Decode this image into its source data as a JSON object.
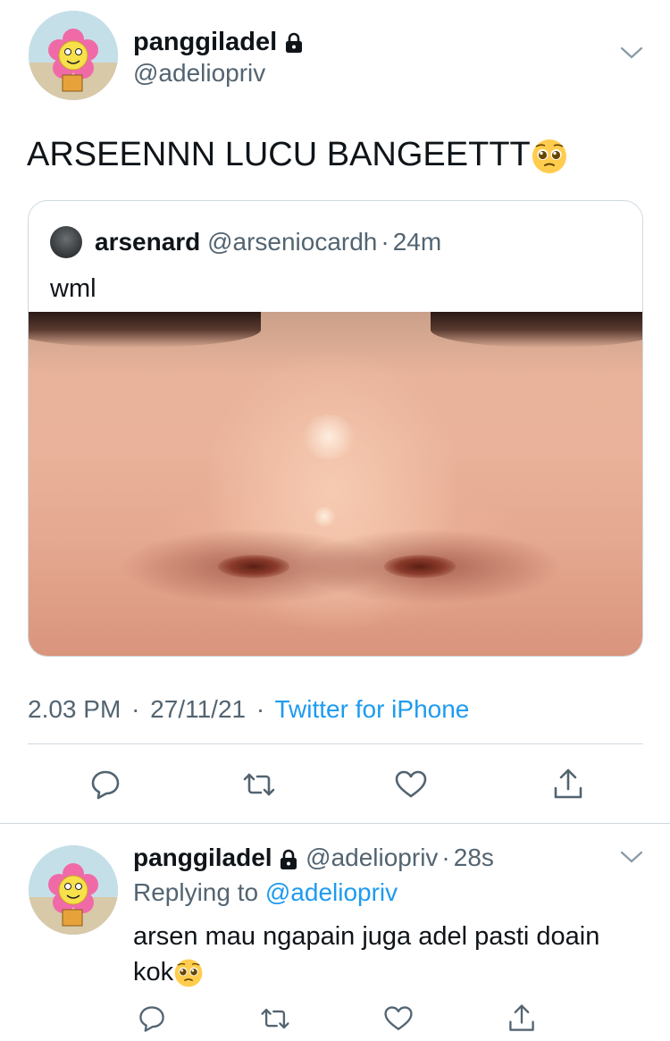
{
  "main_tweet": {
    "display_name": "panggiladel",
    "handle": "@adeliopriv",
    "text": "ARSEENNN LUCU BANGEETTT",
    "emoji": "pleading-face-emoji",
    "protected": true
  },
  "quoted_tweet": {
    "display_name": "arsenard",
    "handle": "@arseniocardh",
    "separator": "·",
    "time": "24m",
    "text": "wml",
    "media": "close-up-face-photo"
  },
  "meta": {
    "time": "2.03 PM",
    "separator": "·",
    "date": "27/11/21",
    "source": "Twitter for iPhone"
  },
  "actions": {
    "reply_icon": "reply-icon",
    "retweet_icon": "retweet-icon",
    "like_icon": "heart-icon",
    "share_icon": "share-icon"
  },
  "reply_tweet": {
    "display_name": "panggiladel",
    "handle": "@adeliopriv",
    "separator": "·",
    "time": "28s",
    "replying_label": "Replying to",
    "replying_handle": "@adeliopriv",
    "text": "arsen mau ngapain juga adel pasti doain kok",
    "protected": true
  },
  "colors": {
    "accent": "#1d9bf0",
    "secondary_text": "#536471",
    "divider": "#cfd9de",
    "primary_text": "#0f1419"
  }
}
